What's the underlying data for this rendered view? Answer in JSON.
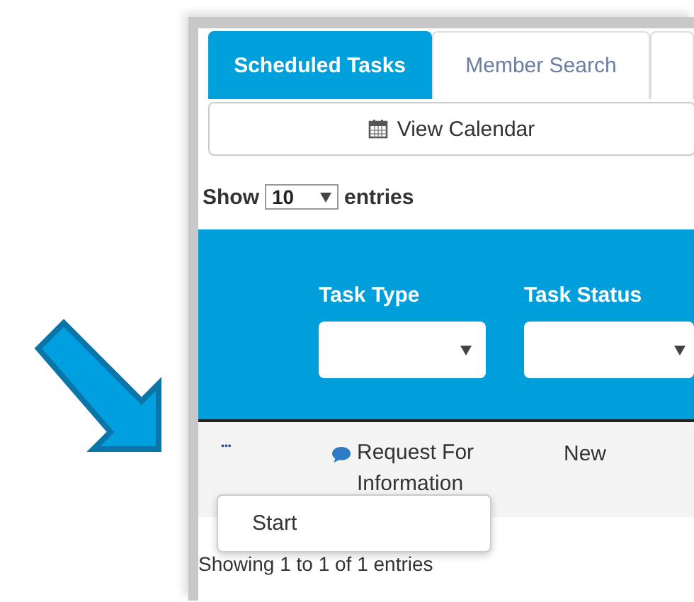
{
  "tabs": [
    {
      "label": "Scheduled Tasks",
      "selected": true
    },
    {
      "label": "Member Search",
      "selected": false
    }
  ],
  "calendar_button": {
    "label": "View Calendar"
  },
  "length_menu": {
    "prefix": "Show",
    "value": "10",
    "suffix": "entries"
  },
  "table": {
    "columns": [
      {
        "label": "Task Type",
        "kind": "dropdown"
      },
      {
        "label": "Task Status",
        "kind": "dropdown"
      }
    ],
    "rows": [
      {
        "actions": "•••",
        "task_type": "Request For Information",
        "task_status": "New"
      }
    ]
  },
  "row_menu": {
    "items": [
      {
        "label": "Start"
      }
    ]
  },
  "info": "Showing 1 to 1 of 1 entries"
}
